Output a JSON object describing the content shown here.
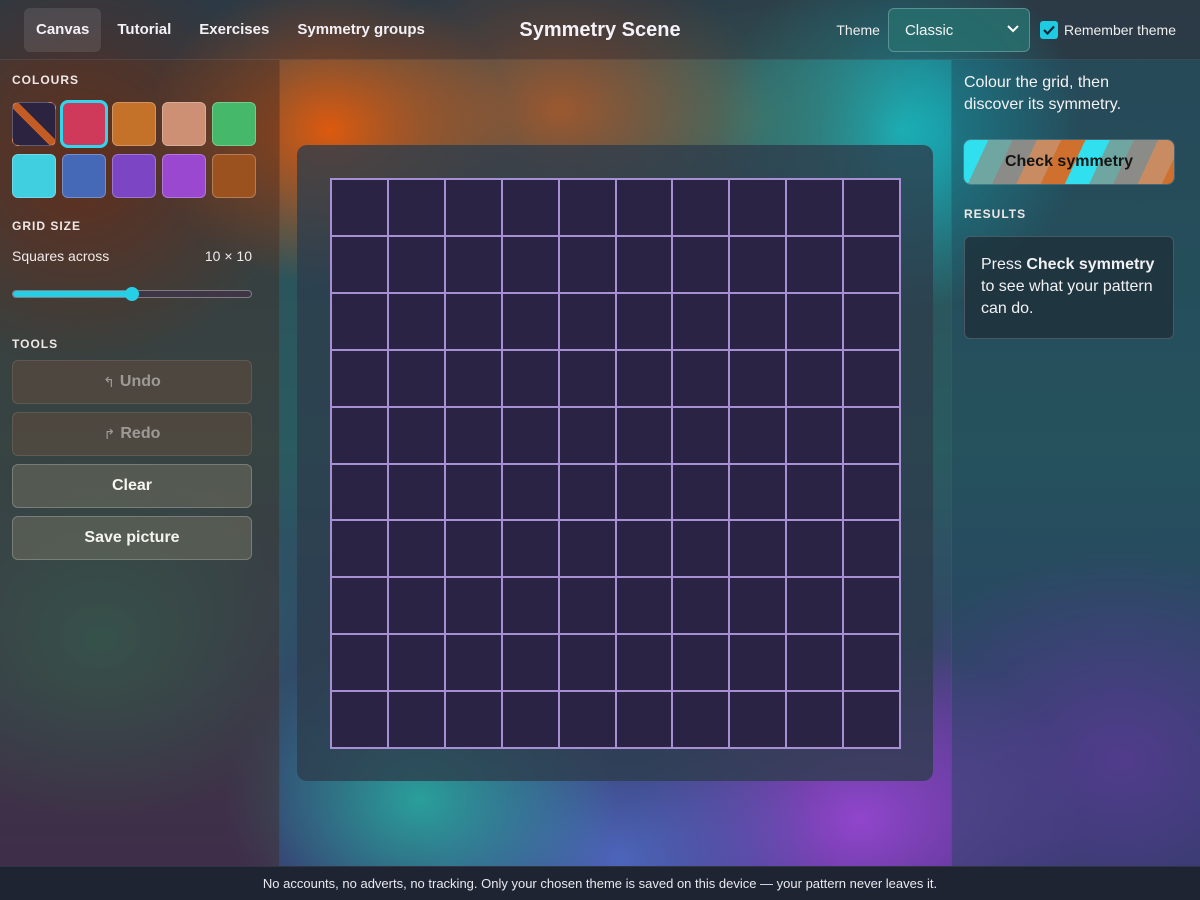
{
  "nav": {
    "tabs": [
      {
        "label": "Canvas",
        "active": true
      },
      {
        "label": "Tutorial",
        "active": false
      },
      {
        "label": "Exercises",
        "active": false
      },
      {
        "label": "Symmetry groups",
        "active": false
      }
    ]
  },
  "app_title": "Symmetry Scene",
  "theme": {
    "label": "Theme",
    "selected": "Classic",
    "remember_label": "Remember theme",
    "remember_checked": true
  },
  "sidebar": {
    "colours_heading": "COLOURS",
    "swatches": [
      {
        "name": "eraser",
        "color": "eraser",
        "selected": false
      },
      {
        "name": "red",
        "color": "#cf3a5a",
        "selected": true
      },
      {
        "name": "orange",
        "color": "#c4712a",
        "selected": false
      },
      {
        "name": "peach",
        "color": "#cd9074",
        "selected": false
      },
      {
        "name": "green",
        "color": "#46b86a",
        "selected": false
      },
      {
        "name": "cyan",
        "color": "#40cfe0",
        "selected": false
      },
      {
        "name": "blue",
        "color": "#4669b7",
        "selected": false
      },
      {
        "name": "indigo",
        "color": "#7c45c4",
        "selected": false
      },
      {
        "name": "purple",
        "color": "#9a48d0",
        "selected": false
      },
      {
        "name": "brown",
        "color": "#9b521e",
        "selected": false
      }
    ],
    "grid_size_heading": "GRID SIZE",
    "squares_across_label": "Squares across",
    "grid_size_value": "10 × 10",
    "slider_fraction": 0.5,
    "tools_heading": "TOOLS",
    "undo_label": "Undo",
    "redo_label": "Redo",
    "clear_label": "Clear",
    "save_label": "Save picture"
  },
  "canvas": {
    "rows": 10,
    "cols": 10,
    "cell_color": "#2b2343",
    "line_color": "#a78fd3"
  },
  "right_panel": {
    "instructions": "Colour the grid, then discover its symmetry.",
    "check_label": "Check symmetry",
    "results_heading": "RESULTS",
    "results_prefix": "Press ",
    "results_bold": "Check symmetry",
    "results_suffix": " to see what your pattern can do."
  },
  "footer": {
    "text": "No accounts, no adverts, no tracking. Only your chosen theme is saved on this device — your pattern never leaves it."
  }
}
